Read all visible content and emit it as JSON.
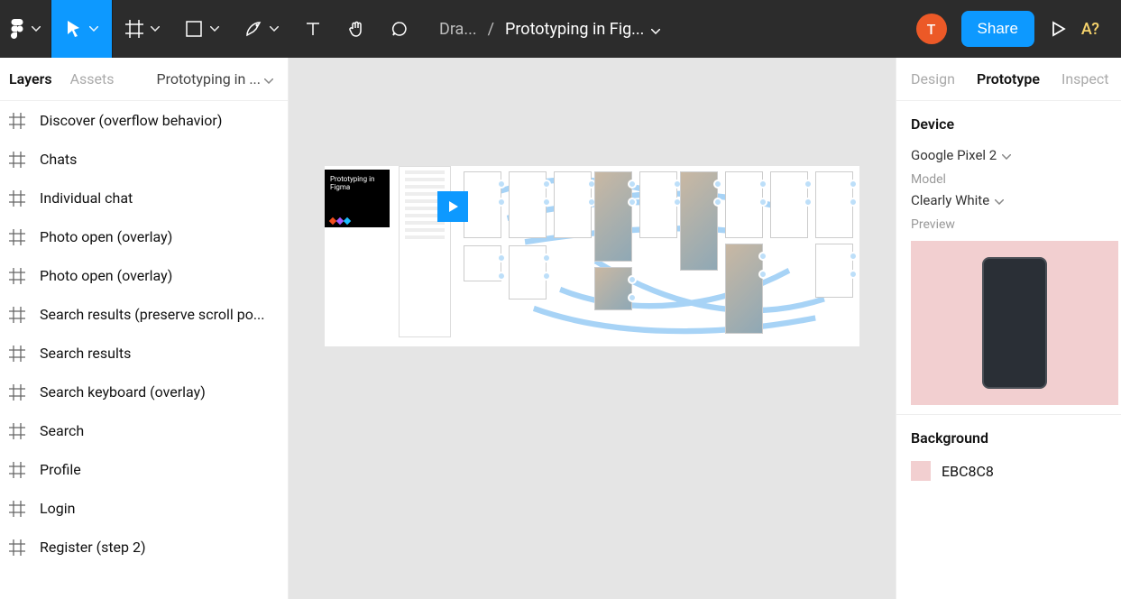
{
  "toolbar": {
    "breadcrumb_parent": "Dra...",
    "breadcrumb_sep": "/",
    "project_title": "Prototyping in Fig...",
    "avatar_initial": "T",
    "share_label": "Share",
    "hint_label": "A?"
  },
  "left_panel": {
    "tab_layers": "Layers",
    "tab_assets": "Assets",
    "page_name": "Prototyping in ...",
    "layers": [
      "Discover (overflow behavior)",
      "Chats",
      "Individual chat",
      "Photo open (overlay)",
      "Photo open (overlay)",
      "Search results (preserve scroll po...",
      "Search results",
      "Search keyboard (overlay)",
      "Search",
      "Profile",
      "Login",
      "Register (step 2)"
    ]
  },
  "canvas": {
    "cover_text": "Prototyping in Figma"
  },
  "right_panel": {
    "tab_design": "Design",
    "tab_prototype": "Prototype",
    "tab_inspect": "Inspect",
    "device_title": "Device",
    "device_value": "Google Pixel 2",
    "model_label": "Model",
    "model_value": "Clearly White",
    "preview_label": "Preview",
    "background_title": "Background",
    "background_value": "EBC8C8",
    "background_color": "#f2cfd0"
  }
}
